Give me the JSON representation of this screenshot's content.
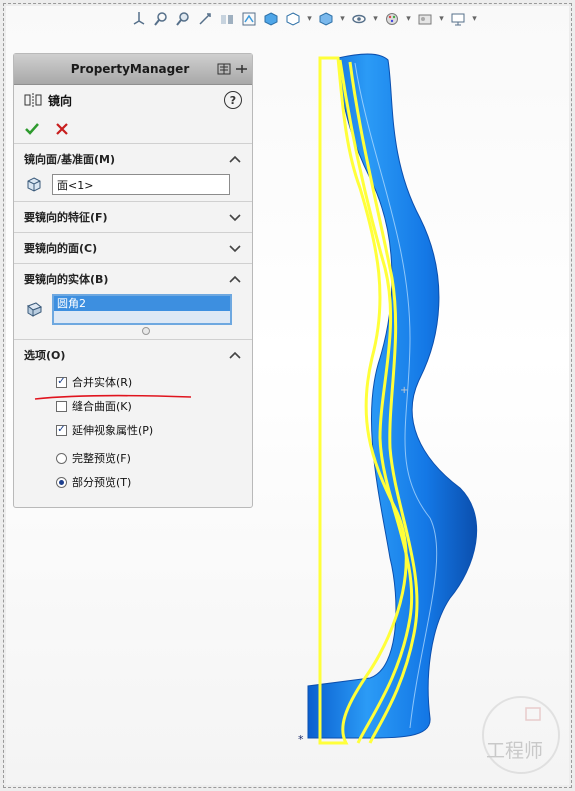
{
  "property_manager": {
    "title": "PropertyManager",
    "feature_name": "镜向",
    "help_label": "?",
    "groups": {
      "mirror_face": {
        "title": "镜向面/基准面(M)",
        "value": "面<1>"
      },
      "features": {
        "title": "要镜向的特征(F)"
      },
      "faces": {
        "title": "要镜向的面(C)"
      },
      "bodies": {
        "title": "要镜向的实体(B)",
        "items": [
          "圆角2"
        ]
      },
      "options": {
        "title": "选项(O)",
        "merge_bodies": {
          "label": "合并实体(R)",
          "checked": true
        },
        "knit_surfaces": {
          "label": "缝合曲面(K)",
          "checked": false
        },
        "propagate_visual": {
          "label": "延伸视象属性(P)",
          "checked": true
        },
        "full_preview": {
          "label": "完整预览(F)",
          "selected": false
        },
        "partial_preview": {
          "label": "部分预览(T)",
          "selected": true
        }
      }
    }
  },
  "toolbar": {
    "icons": [
      "view-orientation-icon",
      "zoom-to-fit-icon",
      "zoom-to-area-icon",
      "previous-view-icon",
      "section-view-icon",
      "dynamic-annotation-icon",
      "view-selector-icon",
      "view-orientation-dropdown-icon",
      "display-style-icon",
      "hide-show-icon",
      "edit-appearance-icon",
      "apply-scene-icon",
      "view-settings-icon"
    ]
  },
  "watermark": {
    "text": "工程师"
  },
  "colors": {
    "model_blue": "#1e88f0",
    "preview_yellow": "#ffff3a",
    "annotation_red": "#e0141e",
    "selection_blue": "#3d8fe0"
  }
}
